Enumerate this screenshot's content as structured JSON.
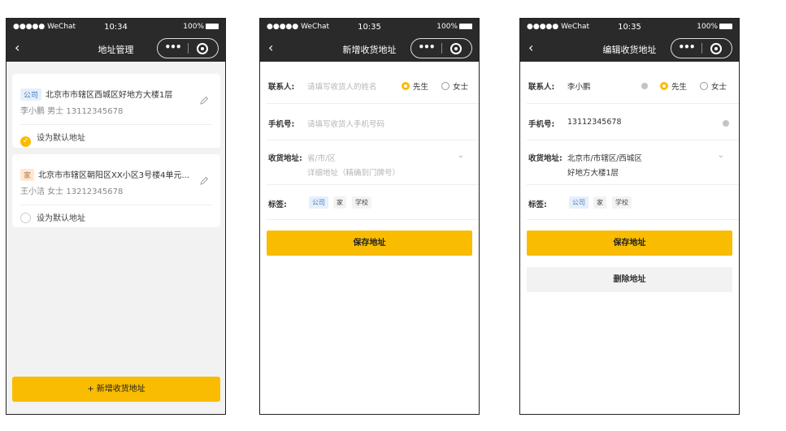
{
  "status": {
    "carrier": "●●●●● WeChat",
    "battery": "100%"
  },
  "screens": [
    {
      "time": "10:34",
      "title": "地址管理",
      "addresses": [
        {
          "tag": "公司",
          "address": "北京市市辖区西城区好地方大楼1层",
          "contact": "李小鹏 男士 13112345678",
          "default_label": "设为默认地址"
        },
        {
          "tag": "家",
          "address": "北京市市辖区朝阳区XX小区3号楼4单元...",
          "contact": "王小洁 女士 13212345678",
          "default_label": "设为默认地址"
        }
      ],
      "add_button": "+ 新增收货地址"
    },
    {
      "time": "10:35",
      "title": "新增收货地址",
      "contact_label": "联系人:",
      "contact_placeholder": "请填写收货人的姓名",
      "gender_male": "先生",
      "gender_female": "女士",
      "phone_label": "手机号:",
      "phone_placeholder": "请填写收货人手机号码",
      "address_label": "收货地址:",
      "region_placeholder": "省/市/区",
      "detail_placeholder": "详细地址（精确到门牌号）",
      "tags_label": "标签:",
      "tags": [
        "公司",
        "家",
        "学校"
      ],
      "save_button": "保存地址"
    },
    {
      "time": "10:35",
      "title": "编辑收货地址",
      "contact_label": "联系人:",
      "contact_value": "李小鹏",
      "gender_male": "先生",
      "gender_female": "女士",
      "phone_label": "手机号:",
      "phone_value": "13112345678",
      "address_label": "收货地址:",
      "region_value": "北京市/市辖区/西城区",
      "detail_value": "好地方大楼1层",
      "tags_label": "标签:",
      "tags": [
        "公司",
        "家",
        "学校"
      ],
      "save_button": "保存地址",
      "delete_button": "删除地址"
    }
  ],
  "colors": {
    "accent": "#f9bc00",
    "navbar": "#2a2a2a",
    "tag_blue_bg": "#e6f0fb",
    "tag_peach_bg": "#fde8d6"
  }
}
